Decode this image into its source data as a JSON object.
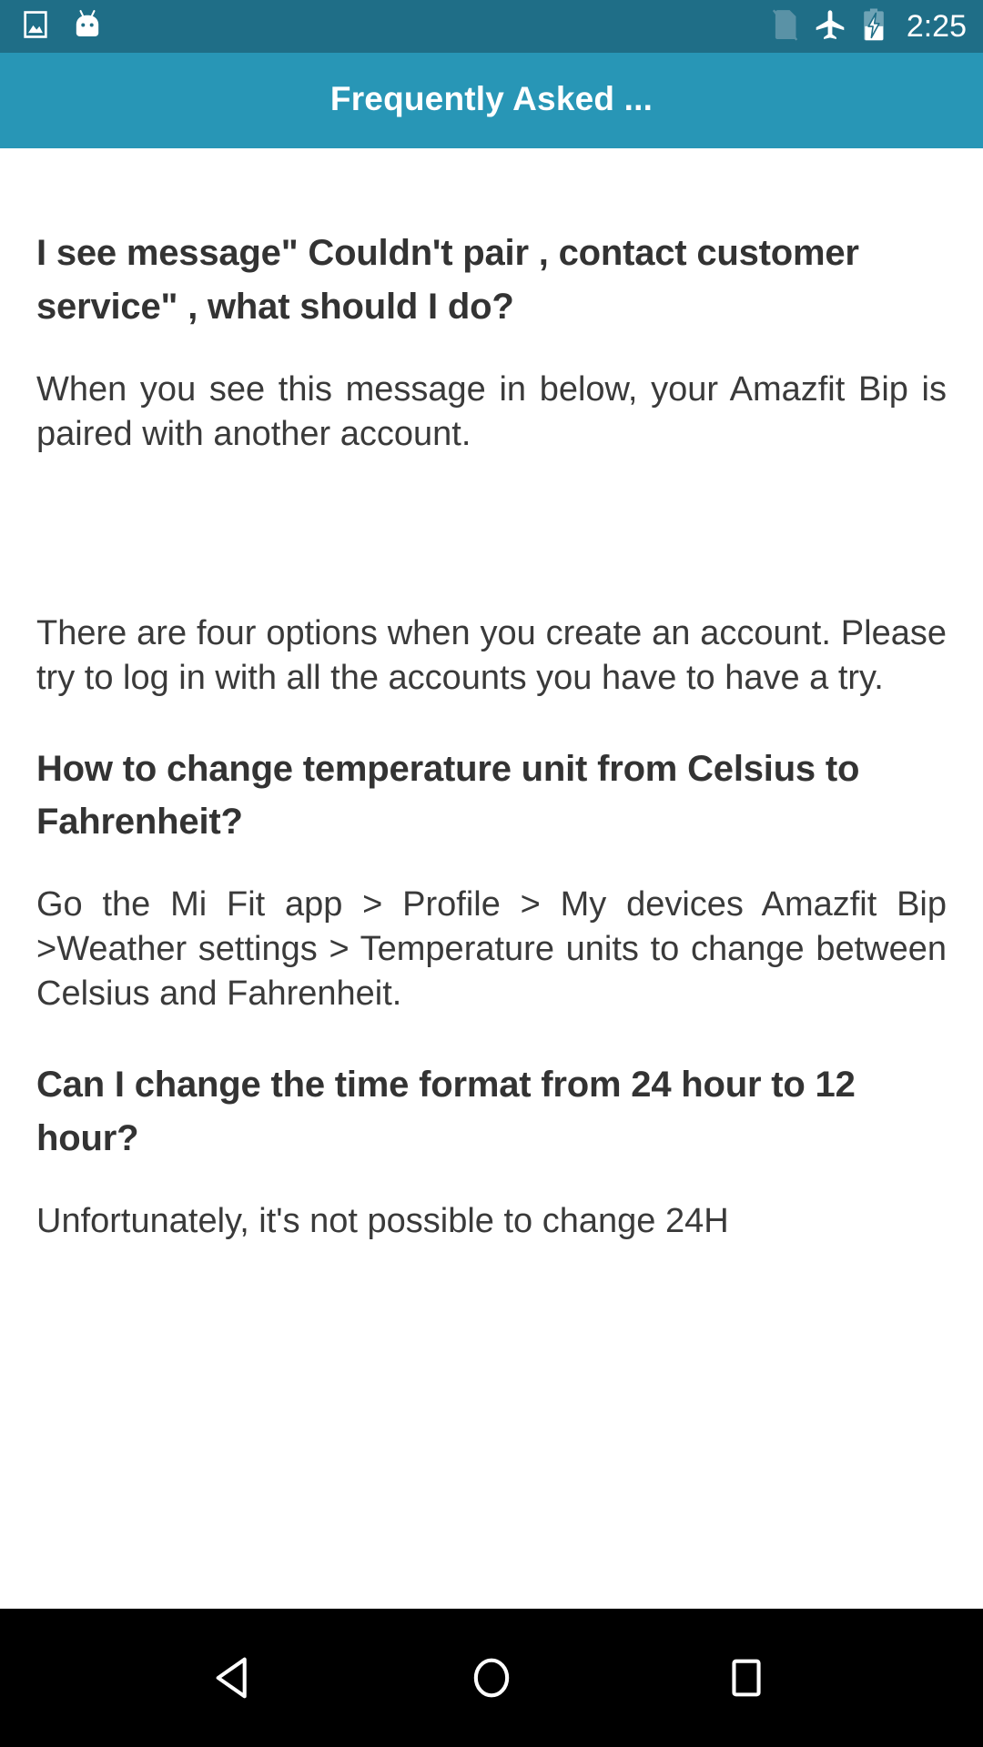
{
  "status_bar": {
    "background": "#1F6E87",
    "icons": [
      {
        "name": "screenshot-image-icon",
        "label": "Screenshot"
      },
      {
        "name": "android-marshmallow-icon",
        "label": "Android System"
      },
      {
        "name": "no-sim-card-icon",
        "label": "No SIM"
      },
      {
        "name": "airplane-mode-icon",
        "label": "Airplane mode"
      },
      {
        "name": "battery-charging-icon",
        "label": "Battery charging"
      }
    ],
    "clock": "2:25"
  },
  "app_bar": {
    "title": "Frequently Asked ...",
    "background": "#2896B6"
  },
  "faq": {
    "items": [
      {
        "question": "I see message\" Couldn't pair , contact customer service\" , what should I do?",
        "answer": "When you see this message in below, your Amazfit Bip is paired with another account.",
        "has_image_gap": true,
        "answer_2": "There are four options when you create an account. Please try to log in with all the accounts you have to have a try."
      },
      {
        "question": "How to change temperature unit from Celsius to Fahrenheit?",
        "answer": "Go the Mi Fit app > Profile > My devices Amazfit Bip >Weather settings > Temperature units to change between Celsius and Fahrenheit."
      },
      {
        "question": "Can I change the time format from 24 hour to 12 hour?",
        "answer": "Unfortunately, it's not possible to change 24H"
      }
    ]
  },
  "nav_bar": {
    "background": "#000000",
    "buttons": [
      {
        "name": "back-button",
        "label": "Back"
      },
      {
        "name": "home-button",
        "label": "Home"
      },
      {
        "name": "recents-button",
        "label": "Recent apps"
      }
    ]
  },
  "colors": {
    "status_bar": "#1F6E87",
    "app_bar": "#2896B6",
    "page_background": "#FFFFFF",
    "heading_text": "#333333",
    "body_text": "#3A3A3A",
    "nav_bar": "#000000"
  }
}
